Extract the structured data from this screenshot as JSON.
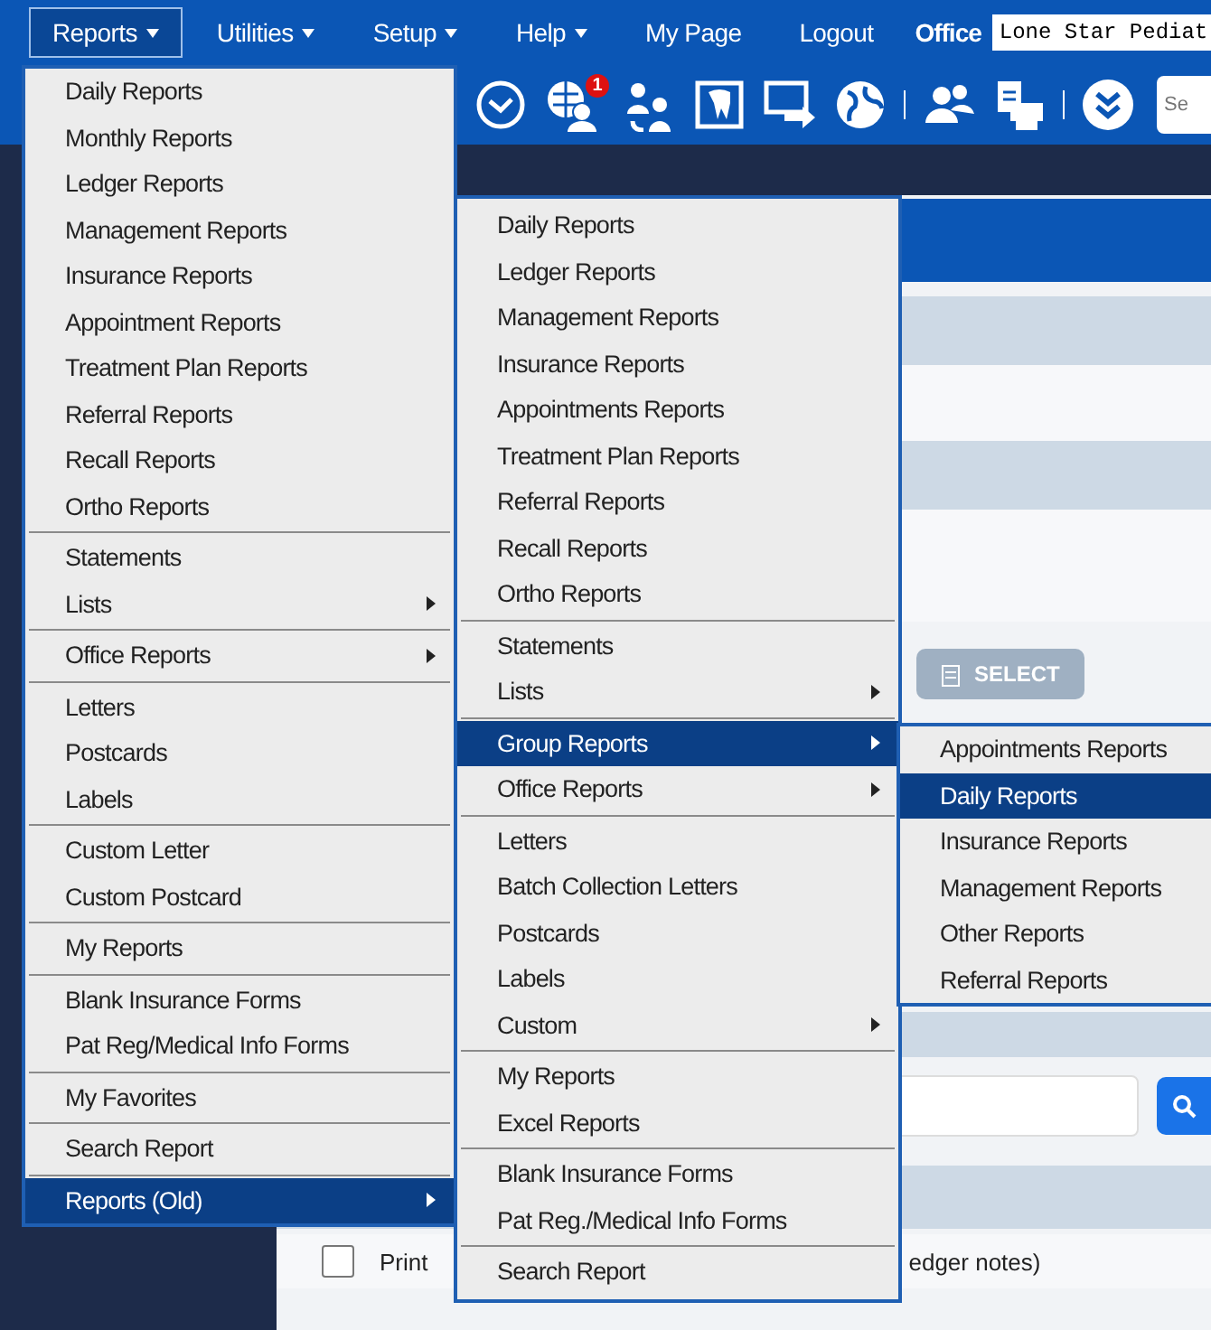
{
  "nav": {
    "items": [
      {
        "label": "Reports",
        "dropdown": true,
        "selected": true
      },
      {
        "label": "Utilities",
        "dropdown": true,
        "selected": false
      },
      {
        "label": "Setup",
        "dropdown": true,
        "selected": false
      },
      {
        "label": "Help",
        "dropdown": true,
        "selected": false
      },
      {
        "label": "My Page",
        "dropdown": false,
        "selected": false
      },
      {
        "label": "Logout",
        "dropdown": false,
        "selected": false
      }
    ],
    "office_label": "Office",
    "office_value": "Lone Star Pediat"
  },
  "toolbar": {
    "notification_badge": "1",
    "search_placeholder": "Se"
  },
  "content": {
    "select_button": "SELECT",
    "select_disabled": true,
    "print_label": "Print",
    "print_checked": false,
    "print_tail": "edger notes)"
  },
  "menus": [
    {
      "groups": [
        [
          {
            "label": "Daily Reports",
            "submenu": false,
            "selected": false
          },
          {
            "label": "Monthly Reports",
            "submenu": false,
            "selected": false
          },
          {
            "label": "Ledger Reports",
            "submenu": false,
            "selected": false
          },
          {
            "label": "Management Reports",
            "submenu": false,
            "selected": false
          },
          {
            "label": "Insurance Reports",
            "submenu": false,
            "selected": false
          },
          {
            "label": "Appointment Reports",
            "submenu": false,
            "selected": false
          },
          {
            "label": "Treatment Plan Reports",
            "submenu": false,
            "selected": false
          },
          {
            "label": "Referral Reports",
            "submenu": false,
            "selected": false
          },
          {
            "label": "Recall Reports",
            "submenu": false,
            "selected": false
          },
          {
            "label": "Ortho Reports",
            "submenu": false,
            "selected": false
          }
        ],
        [
          {
            "label": "Statements",
            "submenu": false,
            "selected": false
          },
          {
            "label": "Lists",
            "submenu": true,
            "selected": false
          }
        ],
        [
          {
            "label": "Office Reports",
            "submenu": true,
            "selected": false
          }
        ],
        [
          {
            "label": "Letters",
            "submenu": false,
            "selected": false
          },
          {
            "label": "Postcards",
            "submenu": false,
            "selected": false
          },
          {
            "label": "Labels",
            "submenu": false,
            "selected": false
          }
        ],
        [
          {
            "label": "Custom Letter",
            "submenu": false,
            "selected": false
          },
          {
            "label": "Custom Postcard",
            "submenu": false,
            "selected": false
          }
        ],
        [
          {
            "label": "My Reports",
            "submenu": false,
            "selected": false
          }
        ],
        [
          {
            "label": "Blank Insurance Forms",
            "submenu": false,
            "selected": false
          },
          {
            "label": "Pat Reg/Medical Info Forms",
            "submenu": false,
            "selected": false
          }
        ],
        [
          {
            "label": "My Favorites",
            "submenu": false,
            "selected": false
          }
        ],
        [
          {
            "label": "Search Report",
            "submenu": false,
            "selected": false
          }
        ],
        [
          {
            "label": "Reports (Old)",
            "submenu": true,
            "selected": true
          }
        ]
      ]
    },
    {
      "groups": [
        [
          {
            "label": "Daily Reports",
            "submenu": false,
            "selected": false
          },
          {
            "label": "Ledger Reports",
            "submenu": false,
            "selected": false
          },
          {
            "label": "Management Reports",
            "submenu": false,
            "selected": false
          },
          {
            "label": "Insurance Reports",
            "submenu": false,
            "selected": false
          },
          {
            "label": "Appointments Reports",
            "submenu": false,
            "selected": false
          },
          {
            "label": "Treatment Plan Reports",
            "submenu": false,
            "selected": false
          },
          {
            "label": "Referral Reports",
            "submenu": false,
            "selected": false
          },
          {
            "label": "Recall Reports",
            "submenu": false,
            "selected": false
          },
          {
            "label": "Ortho Reports",
            "submenu": false,
            "selected": false
          }
        ],
        [
          {
            "label": "Statements",
            "submenu": false,
            "selected": false
          },
          {
            "label": "Lists",
            "submenu": true,
            "selected": false
          }
        ],
        [
          {
            "label": "Group Reports",
            "submenu": true,
            "selected": true
          },
          {
            "label": "Office Reports",
            "submenu": true,
            "selected": false
          }
        ],
        [
          {
            "label": "Letters",
            "submenu": false,
            "selected": false
          },
          {
            "label": "Batch Collection Letters",
            "submenu": false,
            "selected": false
          },
          {
            "label": "Postcards",
            "submenu": false,
            "selected": false
          },
          {
            "label": "Labels",
            "submenu": false,
            "selected": false
          },
          {
            "label": "Custom",
            "submenu": true,
            "selected": false
          }
        ],
        [
          {
            "label": "My Reports",
            "submenu": false,
            "selected": false
          },
          {
            "label": "Excel Reports",
            "submenu": false,
            "selected": false
          }
        ],
        [
          {
            "label": "Blank Insurance Forms",
            "submenu": false,
            "selected": false
          },
          {
            "label": "Pat Reg./Medical Info Forms",
            "submenu": false,
            "selected": false
          }
        ],
        [
          {
            "label": "Search Report",
            "submenu": false,
            "selected": false
          }
        ]
      ]
    },
    {
      "groups": [
        [
          {
            "label": "Appointments Reports",
            "submenu": false,
            "selected": false
          },
          {
            "label": "Daily Reports",
            "submenu": false,
            "selected": true
          },
          {
            "label": "Insurance Reports",
            "submenu": false,
            "selected": false
          },
          {
            "label": "Management Reports",
            "submenu": false,
            "selected": false
          },
          {
            "label": "Other Reports",
            "submenu": false,
            "selected": false
          },
          {
            "label": "Referral Reports",
            "submenu": false,
            "selected": false
          }
        ]
      ]
    }
  ]
}
